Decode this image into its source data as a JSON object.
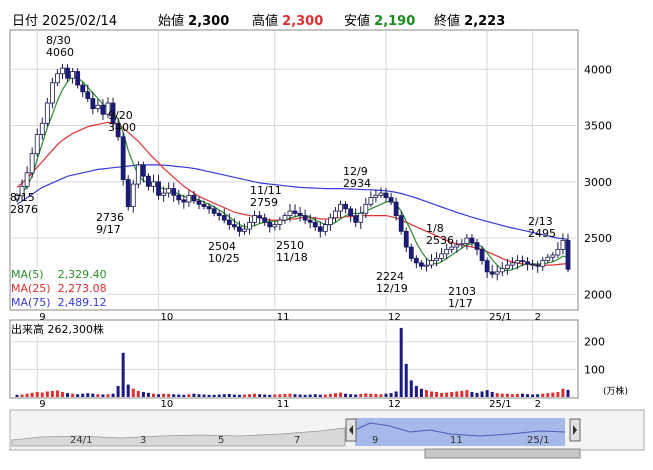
{
  "header": {
    "date_label": "日付",
    "date": "2025/02/14",
    "open_label": "始値",
    "open": "2,300",
    "high_label": "高値",
    "high": "2,300",
    "low_label": "安値",
    "low": "2,190",
    "close_label": "終値",
    "close": "2,223"
  },
  "ma": [
    {
      "label": "MA(5)",
      "value": "2,329.40",
      "color": "#2e8b2e"
    },
    {
      "label": "MA(25)",
      "value": "2,273.08",
      "color": "#e03030"
    },
    {
      "label": "MA(75)",
      "value": "2,489.12",
      "color": "#3a3ad8"
    }
  ],
  "volume": {
    "label": "出来高",
    "value": "262,300株",
    "unit": "(万株)"
  },
  "colors": {
    "up": "#ffffff",
    "down": "#1a1a80",
    "grid": "#d8d8d8",
    "vol": "#1a1a80",
    "vol_up": "#e03030",
    "nav_fill": "#9fb3e8"
  },
  "chart_data": {
    "type": "candlestick",
    "y_ticks": [
      "4000",
      "3500",
      "3000",
      "2500",
      "2000"
    ],
    "ylim": [
      1870,
      4340
    ],
    "x_month_labels": [
      "9",
      "10",
      "11",
      "12",
      "25/1",
      "2"
    ],
    "annotations": [
      {
        "date": "8/30",
        "value": "4060"
      },
      {
        "date": "9/20",
        "value": "3400"
      },
      {
        "date": "8/15",
        "value": "2876"
      },
      {
        "date": "9/17",
        "value": "2736"
      },
      {
        "date": "10/25",
        "value": "2504"
      },
      {
        "date": "11/11",
        "value": "2759"
      },
      {
        "date": "11/18",
        "value": "2510"
      },
      {
        "date": "12/9",
        "value": "2934"
      },
      {
        "date": "12/19",
        "value": "2224"
      },
      {
        "date": "1/8",
        "value": "2536"
      },
      {
        "date": "1/17",
        "value": "2103"
      },
      {
        "date": "2/13",
        "value": "2495"
      }
    ],
    "closes": [
      2876,
      2960,
      3080,
      3250,
      3420,
      3520,
      3700,
      3880,
      3960,
      4010,
      3920,
      3980,
      3860,
      3800,
      3740,
      3650,
      3680,
      3600,
      3700,
      3520,
      3400,
      3020,
      2780,
      2980,
      3150,
      3050,
      2960,
      3000,
      2880,
      2900,
      2940,
      2880,
      2840,
      2820,
      2880,
      2830,
      2800,
      2780,
      2760,
      2720,
      2700,
      2660,
      2620,
      2600,
      2560,
      2580,
      2640,
      2700,
      2680,
      2640,
      2600,
      2620,
      2660,
      2700,
      2740,
      2720,
      2700,
      2660,
      2640,
      2600,
      2560,
      2620,
      2680,
      2740,
      2800,
      2760,
      2700,
      2640,
      2720,
      2800,
      2860,
      2880,
      2900,
      2860,
      2820,
      2700,
      2560,
      2420,
      2320,
      2280,
      2250,
      2260,
      2300,
      2320,
      2360,
      2400,
      2420,
      2440,
      2450,
      2500,
      2460,
      2400,
      2300,
      2200,
      2180,
      2200,
      2230,
      2260,
      2280,
      2300,
      2290,
      2270,
      2260,
      2250,
      2300,
      2330,
      2350,
      2400,
      2480,
      2223
    ],
    "ma5": [
      2876,
      2900,
      2960,
      3050,
      3200,
      3340,
      3480,
      3600,
      3720,
      3820,
      3890,
      3940,
      3920,
      3890,
      3840,
      3790,
      3740,
      3690,
      3660,
      3610,
      3560,
      3440,
      3280,
      3160,
      3060,
      3010,
      2990,
      2990,
      2950,
      2940,
      2930,
      2910,
      2890,
      2870,
      2860,
      2850,
      2840,
      2820,
      2800,
      2780,
      2750,
      2720,
      2690,
      2650,
      2620,
      2600,
      2600,
      2610,
      2630,
      2640,
      2650,
      2650,
      2650,
      2660,
      2680,
      2690,
      2700,
      2700,
      2690,
      2660,
      2640,
      2620,
      2620,
      2640,
      2670,
      2700,
      2720,
      2720,
      2720,
      2740,
      2760,
      2780,
      2800,
      2820,
      2830,
      2800,
      2740,
      2650,
      2560,
      2460,
      2380,
      2320,
      2280,
      2270,
      2290,
      2320,
      2350,
      2380,
      2410,
      2440,
      2450,
      2450,
      2420,
      2370,
      2310,
      2260,
      2220,
      2210,
      2220,
      2240,
      2260,
      2270,
      2270,
      2270,
      2270,
      2280,
      2290,
      2310,
      2340,
      2329
    ],
    "ma25": [
      2950,
      2990,
      3030,
      3080,
      3130,
      3180,
      3230,
      3280,
      3330,
      3370,
      3400,
      3430,
      3450,
      3470,
      3490,
      3500,
      3510,
      3520,
      3530,
      3520,
      3510,
      3480,
      3440,
      3400,
      3360,
      3310,
      3260,
      3210,
      3170,
      3120,
      3080,
      3040,
      3000,
      2960,
      2930,
      2900,
      2870,
      2850,
      2830,
      2810,
      2790,
      2770,
      2750,
      2730,
      2720,
      2710,
      2700,
      2690,
      2680,
      2670,
      2660,
      2660,
      2660,
      2660,
      2670,
      2670,
      2680,
      2680,
      2680,
      2680,
      2670,
      2670,
      2670,
      2680,
      2680,
      2690,
      2690,
      2690,
      2700,
      2700,
      2700,
      2700,
      2700,
      2700,
      2690,
      2680,
      2660,
      2640,
      2620,
      2600,
      2580,
      2560,
      2540,
      2520,
      2500,
      2480,
      2460,
      2450,
      2440,
      2430,
      2420,
      2410,
      2400,
      2380,
      2360,
      2340,
      2320,
      2300,
      2290,
      2280,
      2270,
      2270,
      2260,
      2260,
      2260,
      2260,
      2260,
      2265,
      2270,
      2273
    ],
    "ma75": [
      2800,
      2830,
      2860,
      2890,
      2920,
      2950,
      2970,
      2990,
      3010,
      3030,
      3050,
      3060,
      3070,
      3080,
      3090,
      3100,
      3110,
      3115,
      3120,
      3125,
      3130,
      3135,
      3140,
      3145,
      3150,
      3150,
      3150,
      3150,
      3150,
      3148,
      3145,
      3140,
      3135,
      3130,
      3125,
      3118,
      3110,
      3100,
      3090,
      3080,
      3070,
      3060,
      3050,
      3040,
      3030,
      3020,
      3010,
      3000,
      2990,
      2985,
      2980,
      2975,
      2970,
      2965,
      2960,
      2955,
      2950,
      2948,
      2946,
      2944,
      2942,
      2940,
      2940,
      2940,
      2940,
      2938,
      2936,
      2934,
      2932,
      2930,
      2928,
      2926,
      2924,
      2920,
      2914,
      2906,
      2896,
      2884,
      2870,
      2856,
      2840,
      2824,
      2808,
      2792,
      2776,
      2760,
      2744,
      2728,
      2714,
      2700,
      2686,
      2672,
      2660,
      2648,
      2636,
      2624,
      2612,
      2600,
      2590,
      2580,
      2570,
      2560,
      2550,
      2540,
      2530,
      2520,
      2510,
      2500,
      2495,
      2489
    ],
    "volumes": [
      8,
      9,
      12,
      15,
      18,
      16,
      20,
      22,
      24,
      18,
      14,
      12,
      10,
      12,
      14,
      12,
      10,
      9,
      10,
      12,
      40,
      160,
      45,
      30,
      22,
      18,
      15,
      12,
      10,
      12,
      11,
      10,
      9,
      8,
      10,
      12,
      10,
      9,
      8,
      8,
      9,
      10,
      11,
      9,
      8,
      9,
      10,
      12,
      10,
      9,
      8,
      9,
      10,
      11,
      12,
      10,
      9,
      8,
      9,
      10,
      8,
      9,
      11,
      14,
      16,
      12,
      10,
      9,
      11,
      13,
      12,
      11,
      10,
      12,
      14,
      20,
      250,
      120,
      60,
      40,
      30,
      25,
      20,
      18,
      15,
      16,
      18,
      20,
      22,
      25,
      18,
      15,
      20,
      25,
      18,
      14,
      12,
      12,
      10,
      11,
      12,
      10,
      9,
      10,
      12,
      14,
      16,
      18,
      30,
      26
    ]
  }
}
